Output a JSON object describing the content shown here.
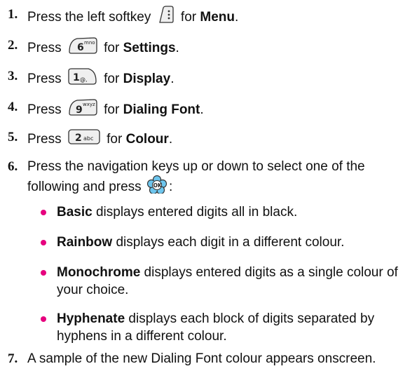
{
  "colors": {
    "bullet": "#e6007e",
    "key_fill": "#efefef",
    "key_stroke": "#333333",
    "ok_fill": "#6ec6ee"
  },
  "steps": [
    {
      "num": "1.",
      "pre": "Press the left softkey",
      "key": "softkey-icon",
      "post1": "for ",
      "bold": "Menu",
      "post2": "."
    },
    {
      "num": "2.",
      "pre": "Press",
      "key_label": "6",
      "key_sub": "mno",
      "post1": "for ",
      "bold": "Settings",
      "post2": "."
    },
    {
      "num": "3.",
      "pre": "Press",
      "key_label": "1",
      "key_sub": "@,",
      "post1": "for ",
      "bold": "Display",
      "post2": "."
    },
    {
      "num": "4.",
      "pre": "Press",
      "key_label": "9",
      "key_sub": "wxyz",
      "post1": "for ",
      "bold": "Dialing Font",
      "post2": "."
    },
    {
      "num": "5.",
      "pre": "Press",
      "key_label": "2",
      "key_sub": "abc",
      "post1": "for ",
      "bold": "Colour",
      "post2": "."
    },
    {
      "num": "6.",
      "line1": "Press the navigation keys up or down to select one of the",
      "line2_pre": "following and press",
      "line2_post": ":"
    },
    {
      "num": "7.",
      "text": "A sample of the new Dialing Font colour appears onscreen."
    }
  ],
  "options": [
    {
      "bold": "Basic",
      "text": " displays entered digits all in black."
    },
    {
      "bold": "Rainbow",
      "text": " displays each digit in a different colour."
    },
    {
      "bold": "Monochrome",
      "text": " displays entered digits as a single colour of",
      "text2": "your choice."
    },
    {
      "bold": "Hyphenate",
      "text": " displays each block of digits separated by",
      "text2": "hyphens in a different colour."
    }
  ]
}
